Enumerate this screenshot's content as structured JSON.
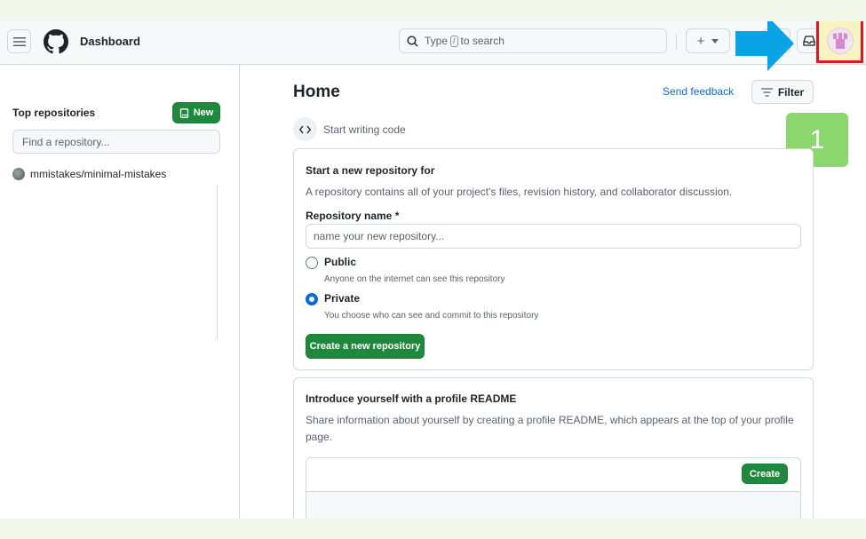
{
  "header": {
    "title": "Dashboard",
    "search": {
      "prefix": "Type",
      "key": "/",
      "suffix": "to search"
    },
    "plus_label": "+",
    "highlight_color": "#e8141b",
    "arrow_color": "#0aa4e6"
  },
  "sidebar": {
    "title": "Top repositories",
    "new_button": "New",
    "find_placeholder": "Find a repository...",
    "repos": [
      {
        "name": "mmistakes/minimal-mistakes"
      }
    ]
  },
  "main": {
    "title": "Home",
    "send_feedback": "Send feedback",
    "filter": "Filter",
    "step_badge": "1",
    "start_writing": "Start writing code",
    "new_repo_card": {
      "title": "Start a new repository for  ",
      "description": "A repository contains all of your project's files, revision history, and collaborator discussion.",
      "name_label": "Repository name *",
      "name_placeholder": "name your new repository...",
      "public_label": "Public",
      "public_desc": "Anyone on the internet can see this repository",
      "private_label": "Private",
      "private_desc": "You choose who can see and commit to this repository",
      "selected_visibility": "Private",
      "create_button": "Create a new repository"
    },
    "readme_card": {
      "title": "Introduce yourself with a profile README",
      "description_line1": "Share information about yourself by creating a profile README, which appears at the top of your profile",
      "description_line2": "page.",
      "create_button": "Create"
    }
  }
}
